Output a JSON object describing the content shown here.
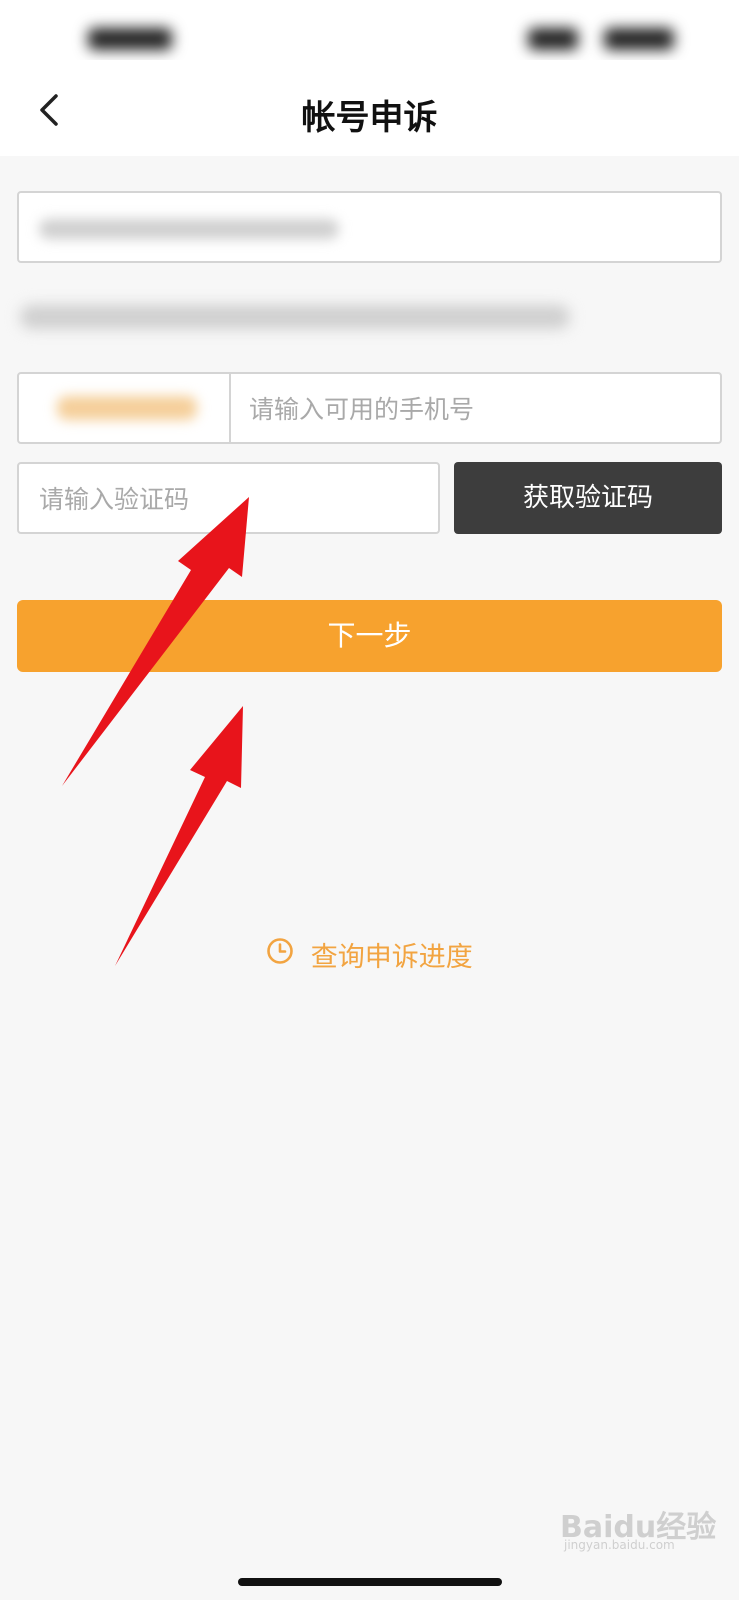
{
  "header": {
    "title": "帐号申诉"
  },
  "form": {
    "phone_placeholder": "请输入可用的手机号",
    "code_placeholder": "请输入验证码",
    "get_code_label": "获取验证码",
    "next_label": "下一步"
  },
  "query_link": {
    "label": "查询申诉进度",
    "icon": "clock-icon"
  },
  "watermark": {
    "text": "Baidu经验",
    "sub": "jingyan.baidu.com"
  },
  "colors": {
    "accent": "#f7a22e",
    "link": "#f2a441",
    "dark_button": "#3d3d3d",
    "annotation_arrow": "#e8141b"
  }
}
